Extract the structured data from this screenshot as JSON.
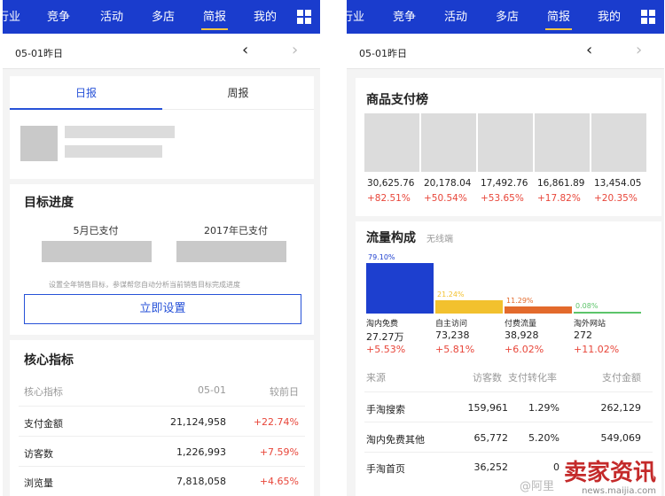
{
  "left": {
    "nav": [
      "行业",
      "竞争",
      "活动",
      "多店",
      "简报",
      "我的"
    ],
    "nav_active": "简报",
    "date": "05-01昨日",
    "tabs": [
      "日报",
      "周报"
    ],
    "goal": {
      "title": "目标进度",
      "col1": "5月已支付",
      "col2": "2017年已支付",
      "hint": "设置全年销售目标，参谋帮您自动分析当前销售目标完成进度",
      "button": "立即设置"
    },
    "core": {
      "title": "核心指标",
      "headers": [
        "核心指标",
        "05-01",
        "较前日"
      ],
      "rows": [
        {
          "name": "支付金额",
          "value": "21,124,958",
          "change": "+22.74%"
        },
        {
          "name": "访客数",
          "value": "1,226,993",
          "change": "+7.59%"
        },
        {
          "name": "浏览量",
          "value": "7,818,058",
          "change": "+4.65%"
        }
      ]
    }
  },
  "right": {
    "nav": [
      "行业",
      "竞争",
      "活动",
      "多店",
      "简报",
      "我的"
    ],
    "nav_active": "简报",
    "date": "05-01昨日",
    "products": {
      "title": "商品支付榜",
      "items": [
        {
          "value": "30,625.76",
          "change": "+82.51%"
        },
        {
          "value": "20,178.04",
          "change": "+50.54%"
        },
        {
          "value": "17,492.76",
          "change": "+53.65%"
        },
        {
          "value": "16,861.89",
          "change": "+17.82%"
        },
        {
          "value": "13,454.05",
          "change": "+20.35%"
        }
      ]
    },
    "traffic": {
      "title": "流量构成",
      "subtitle": "无线端",
      "bars": [
        {
          "pct_label": "79.10%",
          "share": 0.791,
          "color": "#1d3fcf",
          "name": "淘内免费",
          "value": "27.27万",
          "change": "+5.53%"
        },
        {
          "pct_label": "21.24%",
          "share": 0.2124,
          "color": "#f2c12e",
          "name": "自主访问",
          "value": "73,238",
          "change": "+5.81%"
        },
        {
          "pct_label": "11.29%",
          "share": 0.1129,
          "color": "#e36a2c",
          "name": "付费流量",
          "value": "38,928",
          "change": "+6.02%"
        },
        {
          "pct_label": "0.08%",
          "share": 0.0008,
          "color": "#5cc46a",
          "name": "淘外网站",
          "value": "272",
          "change": "+11.02%"
        }
      ],
      "table_headers": [
        "来源",
        "访客数",
        "支付转化率",
        "支付金额"
      ],
      "rows": [
        {
          "source": "手淘搜索",
          "visitors": "159,961",
          "rate": "1.29%",
          "amount": "262,129"
        },
        {
          "source": "淘内免费其他",
          "visitors": "65,772",
          "rate": "5.20%",
          "amount": "549,069"
        },
        {
          "source": "手淘首页",
          "visitors": "36,252",
          "rate": "0",
          "amount": ""
        }
      ]
    }
  },
  "watermark": {
    "brand": "卖家资讯",
    "url": "news.maijia.com",
    "prefix": "@阿里"
  },
  "colors": {
    "nav_bg": "#1a3ccd",
    "accent": "#2752d8",
    "positive": "#e8463a",
    "tab_underline": "#f6c444"
  }
}
